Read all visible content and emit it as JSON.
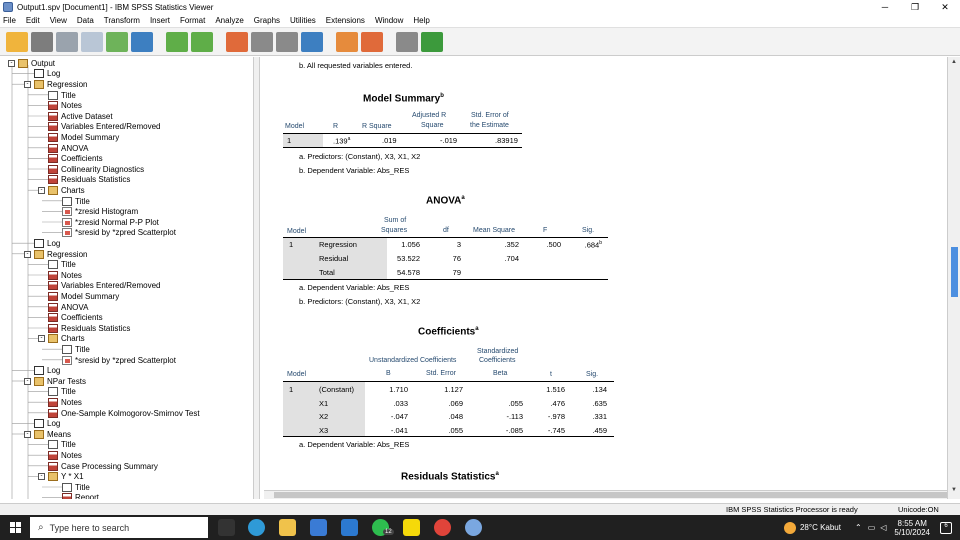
{
  "window": {
    "title": "Output1.spv [Document1] - IBM SPSS Statistics Viewer",
    "min": "─",
    "max": "❐",
    "close": "✕"
  },
  "menu": [
    "File",
    "Edit",
    "View",
    "Data",
    "Transform",
    "Insert",
    "Format",
    "Analyze",
    "Graphs",
    "Utilities",
    "Extensions",
    "Window",
    "Help"
  ],
  "tree": [
    {
      "d": 0,
      "t": "Output",
      "i": "book",
      "e": "-"
    },
    {
      "d": 1,
      "t": "Log",
      "i": "log"
    },
    {
      "d": 1,
      "t": "Regression",
      "i": "book",
      "e": "-"
    },
    {
      "d": 2,
      "t": "Title",
      "i": "doc"
    },
    {
      "d": 2,
      "t": "Notes",
      "i": "tbl"
    },
    {
      "d": 2,
      "t": "Active Dataset",
      "i": "tbl"
    },
    {
      "d": 2,
      "t": "Variables Entered/Removed",
      "i": "tbl"
    },
    {
      "d": 2,
      "t": "Model Summary",
      "i": "tbl"
    },
    {
      "d": 2,
      "t": "ANOVA",
      "i": "tbl"
    },
    {
      "d": 2,
      "t": "Coefficients",
      "i": "tbl"
    },
    {
      "d": 2,
      "t": "Collinearity Diagnostics",
      "i": "tbl"
    },
    {
      "d": 2,
      "t": "Residuals Statistics",
      "i": "tbl"
    },
    {
      "d": 2,
      "t": "Charts",
      "i": "book",
      "e": "-"
    },
    {
      "d": 3,
      "t": "Title",
      "i": "doc"
    },
    {
      "d": 3,
      "t": "*zresid Histogram",
      "i": "chart"
    },
    {
      "d": 3,
      "t": "*zresid Normal P-P Plot",
      "i": "chart"
    },
    {
      "d": 3,
      "t": "*sresid by *zpred Scatterplot",
      "i": "chart"
    },
    {
      "d": 1,
      "t": "Log",
      "i": "log"
    },
    {
      "d": 1,
      "t": "Regression",
      "i": "book",
      "e": "-"
    },
    {
      "d": 2,
      "t": "Title",
      "i": "doc"
    },
    {
      "d": 2,
      "t": "Notes",
      "i": "tbl"
    },
    {
      "d": 2,
      "t": "Variables Entered/Removed",
      "i": "tbl"
    },
    {
      "d": 2,
      "t": "Model Summary",
      "i": "tbl"
    },
    {
      "d": 2,
      "t": "ANOVA",
      "i": "tbl"
    },
    {
      "d": 2,
      "t": "Coefficients",
      "i": "tbl"
    },
    {
      "d": 2,
      "t": "Residuals Statistics",
      "i": "tbl"
    },
    {
      "d": 2,
      "t": "Charts",
      "i": "book",
      "e": "-"
    },
    {
      "d": 3,
      "t": "Title",
      "i": "doc"
    },
    {
      "d": 3,
      "t": "*sresid by *zpred Scatterplot",
      "i": "chart"
    },
    {
      "d": 1,
      "t": "Log",
      "i": "log"
    },
    {
      "d": 1,
      "t": "NPar Tests",
      "i": "book",
      "e": "-"
    },
    {
      "d": 2,
      "t": "Title",
      "i": "doc"
    },
    {
      "d": 2,
      "t": "Notes",
      "i": "tbl"
    },
    {
      "d": 2,
      "t": "One-Sample Kolmogorov-Smirnov Test",
      "i": "tbl"
    },
    {
      "d": 1,
      "t": "Log",
      "i": "log"
    },
    {
      "d": 1,
      "t": "Means",
      "i": "book",
      "e": "-"
    },
    {
      "d": 2,
      "t": "Title",
      "i": "doc"
    },
    {
      "d": 2,
      "t": "Notes",
      "i": "tbl"
    },
    {
      "d": 2,
      "t": "Case Processing Summary",
      "i": "tbl"
    },
    {
      "d": 2,
      "t": "Y * X1",
      "i": "book",
      "e": "-"
    },
    {
      "d": 3,
      "t": "Title",
      "i": "doc"
    },
    {
      "d": 3,
      "t": "Report",
      "i": "tbl"
    }
  ],
  "output": {
    "top_note": "b. All requested variables entered.",
    "model_summary": {
      "title": "Model Summary",
      "sup": "b",
      "headers": [
        "Model",
        "R",
        "R Square",
        "Adjusted R Square",
        "Std. Error of the Estimate"
      ],
      "adj_h1": "Adjusted R",
      "adj_h2": "Square",
      "se_h1": "Std. Error of",
      "se_h2": "the Estimate",
      "row": [
        "1",
        ".139",
        "a",
        ".019",
        "-.019",
        ".83919"
      ],
      "note_a": "a. Predictors: (Constant), X3, X1, X2",
      "note_b": "b. Dependent Variable: Abs_RES"
    },
    "anova": {
      "title": "ANOVA",
      "sup": "a",
      "h_model": "Model",
      "h_ss1": "Sum of",
      "h_ss2": "Squares",
      "h_df": "df",
      "h_ms": "Mean Square",
      "h_f": "F",
      "h_sig": "Sig.",
      "rows": [
        {
          "m": "1",
          "name": "Regression",
          "ss": "1.056",
          "df": "3",
          "ms": ".352",
          "f": ".500",
          "sig": ".684",
          "sup": "b"
        },
        {
          "m": "",
          "name": "Residual",
          "ss": "53.522",
          "df": "76",
          "ms": ".704",
          "f": "",
          "sig": "",
          "sup": ""
        },
        {
          "m": "",
          "name": "Total",
          "ss": "54.578",
          "df": "79",
          "ms": "",
          "f": "",
          "sig": "",
          "sup": ""
        }
      ],
      "note_a": "a. Dependent Variable: Abs_RES",
      "note_b": "b. Predictors: (Constant), X3, X1, X2"
    },
    "coefficients": {
      "title": "Coefficients",
      "sup": "a",
      "h_unstd": "Unstandardized Coefficients",
      "h_std1": "Standardized",
      "h_std2": "Coefficients",
      "h_model": "Model",
      "h_b": "B",
      "h_se": "Std. Error",
      "h_beta": "Beta",
      "h_t": "t",
      "h_sig": "Sig.",
      "rows": [
        {
          "m": "1",
          "name": "(Constant)",
          "b": "1.710",
          "se": "1.127",
          "beta": "",
          "t": "1.516",
          "sig": ".134"
        },
        {
          "m": "",
          "name": "X1",
          "b": ".033",
          "se": ".069",
          "beta": ".055",
          "t": ".476",
          "sig": ".635"
        },
        {
          "m": "",
          "name": "X2",
          "b": "-.047",
          "se": ".048",
          "beta": "-.113",
          "t": "-.978",
          "sig": ".331"
        },
        {
          "m": "",
          "name": "X3",
          "b": "-.041",
          "se": ".055",
          "beta": "-.085",
          "t": "-.745",
          "sig": ".459"
        }
      ],
      "note_a": "a. Dependent Variable: Abs_RES"
    },
    "residuals": {
      "title": "Residuals Statistics",
      "sup": "a"
    }
  },
  "status": {
    "processor": "IBM SPSS Statistics Processor is ready",
    "unicode": "Unicode:ON"
  },
  "taskbar": {
    "search": "Type here to search",
    "weather": "28°C  Kabut",
    "time": "8:55 AM",
    "date": "5/10/2024",
    "whatsapp_badge": "12"
  }
}
